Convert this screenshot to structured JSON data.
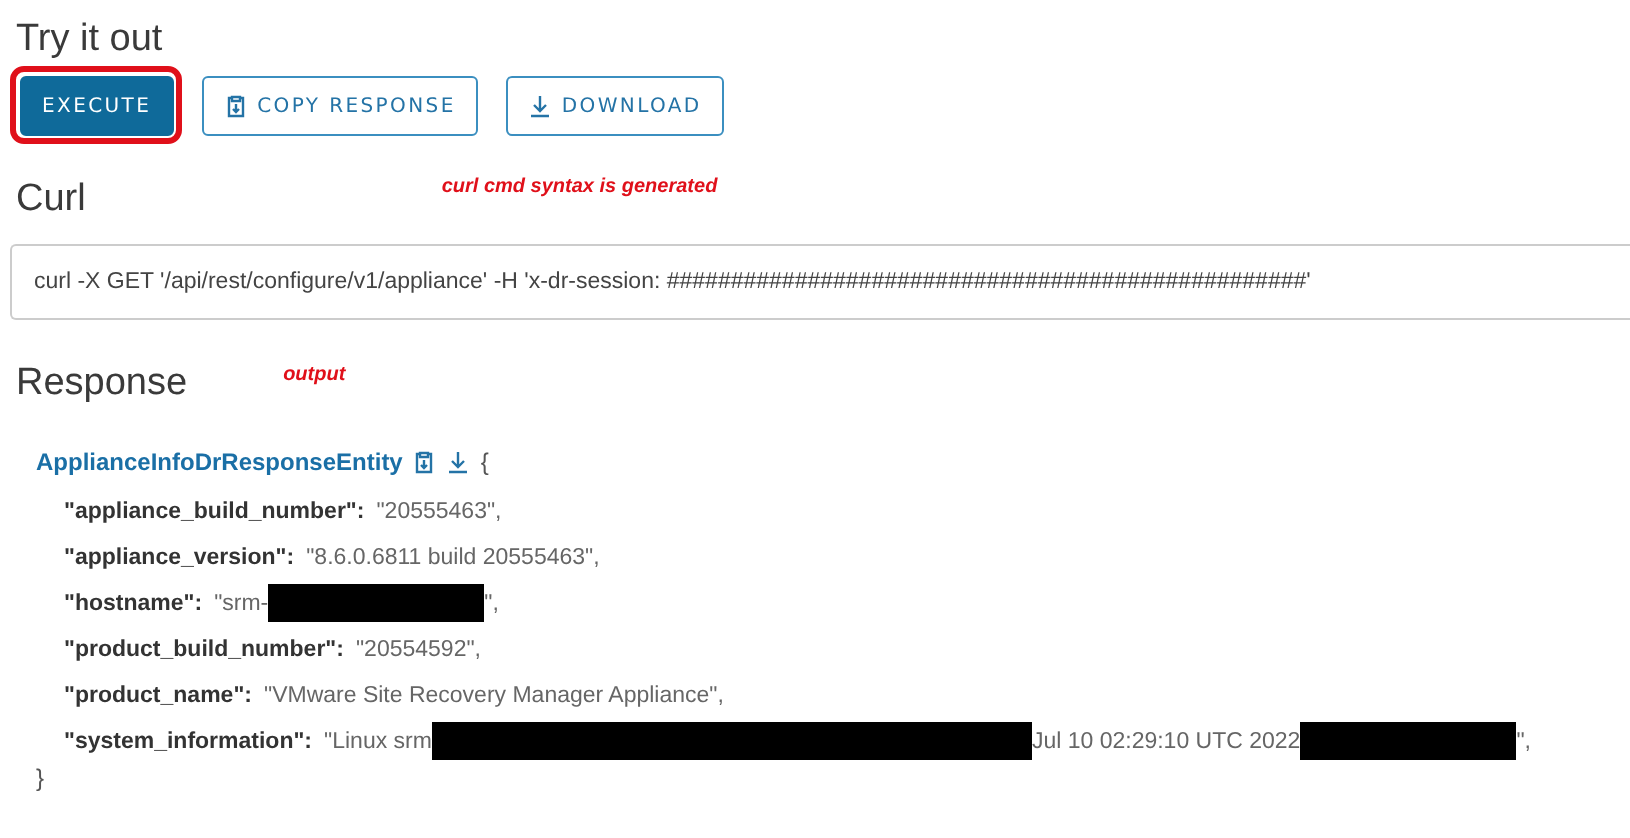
{
  "try_section": {
    "title": "Try it out",
    "buttons": [
      {
        "label": "EXECUTE",
        "kind": "primary",
        "highlighted": true
      },
      {
        "label": "COPY RESPONSE",
        "kind": "copy",
        "highlighted": false
      },
      {
        "label": "DOWNLOAD",
        "kind": "download",
        "highlighted": false
      }
    ]
  },
  "curl_section": {
    "title": "Curl",
    "annotation": "curl cmd syntax is generated",
    "command": "curl -X GET '/api/rest/configure/v1/appliance' -H 'x-dr-session: ##################################################'"
  },
  "response_section": {
    "title": "Response",
    "annotation": "output",
    "entity": "ApplianceInfoDrResponseEntity",
    "open_brace": "{",
    "close_brace": "}",
    "fields": [
      {
        "key": "\"appliance_build_number\":",
        "value": [
          {
            "kind": "text",
            "text": "\"20555463\","
          }
        ]
      },
      {
        "key": "\"appliance_version\":",
        "value": [
          {
            "kind": "text",
            "text": "\"8.6.0.6811 build 20555463\","
          }
        ]
      },
      {
        "key": "\"hostname\":",
        "value": [
          {
            "kind": "text",
            "text": "\"srm-"
          },
          {
            "kind": "redacted_medium"
          },
          {
            "kind": "text",
            "text": "\","
          }
        ]
      },
      {
        "key": "\"product_build_number\":",
        "value": [
          {
            "kind": "text",
            "text": "\"20554592\","
          }
        ]
      },
      {
        "key": "\"product_name\":",
        "value": [
          {
            "kind": "text",
            "text": "\"VMware Site Recovery Manager Appliance\","
          }
        ]
      },
      {
        "key": "\"system_information\":",
        "value": [
          {
            "kind": "text",
            "text": "\"Linux srm"
          },
          {
            "kind": "redacted_long"
          },
          {
            "kind": "text",
            "text": "Jul 10 02:29:10 UTC 2022"
          },
          {
            "kind": "redacted_medium"
          },
          {
            "kind": "text",
            "text": "\","
          }
        ]
      }
    ]
  }
}
